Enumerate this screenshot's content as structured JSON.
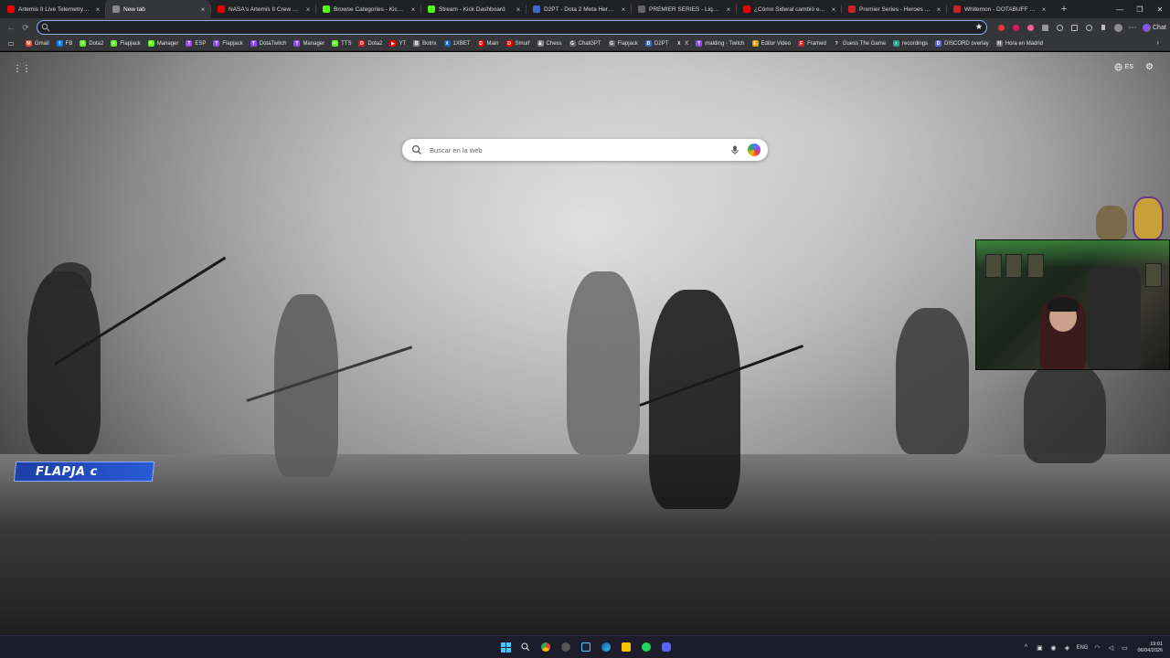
{
  "tabs": [
    {
      "title": "Artemis II Live Telemetry & Raw",
      "fav_color": "#e00",
      "active": false
    },
    {
      "title": "New tab",
      "fav_color": "#888",
      "active": true
    },
    {
      "title": "NASA's Artemis II Crew Flies Aro",
      "fav_color": "#e00",
      "active": false
    },
    {
      "title": "Browse Categories - Kick Stream",
      "fav_color": "#53fc18",
      "active": false
    },
    {
      "title": "Stream - Kick Dashboard",
      "fav_color": "#53fc18",
      "active": false
    },
    {
      "title": "D2PT - Dota 2 Meta Heroes 7.41",
      "fav_color": "#3a6ad0",
      "active": false
    },
    {
      "title": "PREMIER SERIES - Liquipedia Do",
      "fav_color": "#666",
      "active": false
    },
    {
      "title": "¿Cómo Sideral cambió el humor",
      "fav_color": "#e00",
      "active": false
    },
    {
      "title": "Premier Series - Heroes - DOTAB",
      "fav_color": "#c22",
      "active": false
    },
    {
      "title": "Whitemon - DOTABUFF - Dota 2",
      "fav_color": "#c22",
      "active": false
    }
  ],
  "toolbar": {
    "url_value": "",
    "chat_label": "Chat"
  },
  "bookmarks": [
    {
      "label": "Gmail",
      "color": "#ea4335",
      "glyph": "M"
    },
    {
      "label": "FB",
      "color": "#1877f2",
      "glyph": "f"
    },
    {
      "label": "Dota2",
      "color": "#53fc18",
      "glyph": "K"
    },
    {
      "label": "Flapjack",
      "color": "#53fc18",
      "glyph": "K"
    },
    {
      "label": "Manager",
      "color": "#53fc18",
      "glyph": "K"
    },
    {
      "label": "ESP",
      "color": "#9146ff",
      "glyph": "T"
    },
    {
      "label": "Flapjack",
      "color": "#9146ff",
      "glyph": "T"
    },
    {
      "label": "DotaTwitch",
      "color": "#9146ff",
      "glyph": "T"
    },
    {
      "label": "Manager",
      "color": "#9146ff",
      "glyph": "T"
    },
    {
      "label": "TTS",
      "color": "#53fc18",
      "glyph": "K"
    },
    {
      "label": "Dota2",
      "color": "#c22",
      "glyph": "D"
    },
    {
      "label": "YT",
      "color": "#e00",
      "glyph": "▶"
    },
    {
      "label": "Botrix",
      "color": "#888",
      "glyph": "B"
    },
    {
      "label": "1XBET",
      "color": "#1d5fb8",
      "glyph": "X"
    },
    {
      "label": "Main",
      "color": "#e00",
      "glyph": "D"
    },
    {
      "label": "Smurf",
      "color": "#e00",
      "glyph": "D"
    },
    {
      "label": "Chess",
      "color": "#888",
      "glyph": "♟"
    },
    {
      "label": "ChatGPT",
      "color": "#666",
      "glyph": "G"
    },
    {
      "label": "Flapjack",
      "color": "#666",
      "glyph": "G"
    },
    {
      "label": "D2PT",
      "color": "#3a6ad0",
      "glyph": "D"
    },
    {
      "label": "X",
      "color": "#333",
      "glyph": "X"
    },
    {
      "label": "malding - Twitch",
      "color": "#9146ff",
      "glyph": "T"
    },
    {
      "label": "Editor Video",
      "color": "#e0a000",
      "glyph": "E"
    },
    {
      "label": "Framed",
      "color": "#c22",
      "glyph": "F"
    },
    {
      "label": "Guess The Game",
      "color": "#333",
      "glyph": "?"
    },
    {
      "label": "recordings",
      "color": "#2a9d8f",
      "glyph": "r"
    },
    {
      "label": "DISCORD overlay",
      "color": "#5865f2",
      "glyph": "D"
    },
    {
      "label": "Hora en Madrid",
      "color": "#777",
      "glyph": "H"
    }
  ],
  "ntp": {
    "search_placeholder": "Buscar en la web",
    "language": "ES"
  },
  "overlay": {
    "banner_text": "FLAPJA c"
  },
  "taskbar": {
    "lang": "ENG",
    "time": "19:01",
    "date": "06/04/2026"
  },
  "colors": {
    "accent": "#8ab4f8",
    "banner": "#2a5ad6"
  }
}
